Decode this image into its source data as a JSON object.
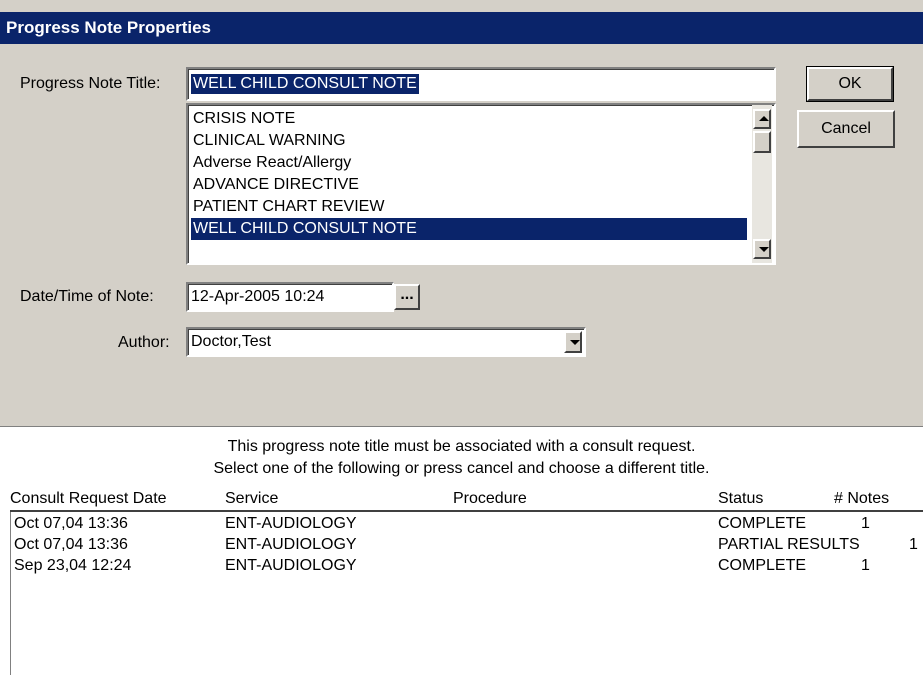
{
  "window": {
    "title": "Progress Note Properties"
  },
  "buttons": {
    "ok": "OK",
    "cancel": "Cancel"
  },
  "form": {
    "title_label": "Progress Note Title:",
    "title_value": "WELL CHILD CONSULT NOTE",
    "date_label": "Date/Time of Note:",
    "date_value": "12-Apr-2005 10:24",
    "date_button": "...",
    "author_label": "Author:",
    "author_value": "Doctor,Test"
  },
  "title_list": {
    "items": [
      "CRISIS NOTE",
      "CLINICAL WARNING",
      "Adverse React/Allergy",
      "ADVANCE DIRECTIVE",
      "PATIENT CHART REVIEW",
      "WELL CHILD CONSULT NOTE"
    ],
    "selected": "WELL CHILD CONSULT NOTE"
  },
  "consult": {
    "message_line1": "This progress note title must be associated with a consult request.",
    "message_line2": "Select one of the following or press cancel and choose a different title.",
    "columns": [
      "Consult Request Date",
      "Service",
      "Procedure",
      "Status",
      "# Notes"
    ],
    "rows": [
      {
        "date": "Oct 07,04 13:36",
        "service": "ENT-AUDIOLOGY",
        "procedure": "",
        "status": "COMPLETE",
        "notes": "1"
      },
      {
        "date": "Oct 07,04 13:36",
        "service": "ENT-AUDIOLOGY",
        "procedure": "",
        "status": "PARTIAL RESULTS",
        "notes": "1"
      },
      {
        "date": "Sep 23,04 12:24",
        "service": "ENT-AUDIOLOGY",
        "procedure": "",
        "status": "COMPLETE",
        "notes": "1"
      }
    ]
  },
  "colors": {
    "titlebar": "#0a246a",
    "selection": "#0a246a",
    "dialog_bg": "#d4d0c8"
  }
}
